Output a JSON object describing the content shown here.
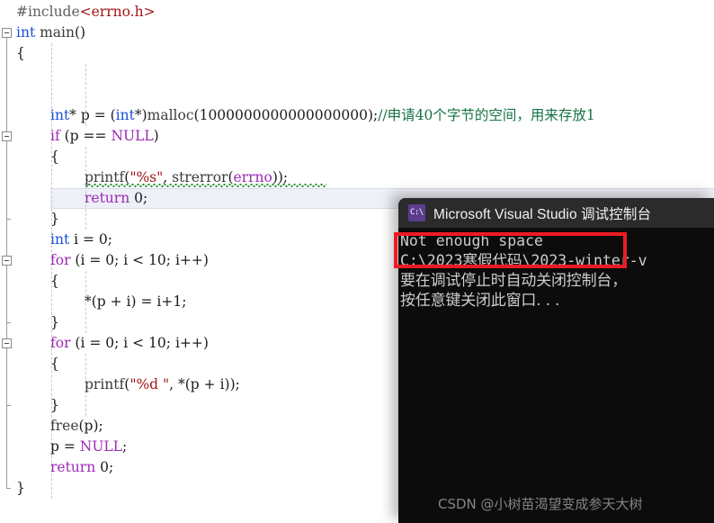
{
  "editor": {
    "name": "visual-studio-code-editor",
    "background": "#ffffff",
    "lines": [
      {
        "indent": 0,
        "tokens": [
          {
            "t": "#include",
            "c": "macro"
          },
          {
            "t": "<errno.h>",
            "c": "hdr"
          }
        ]
      },
      {
        "indent": 0,
        "tokens": [
          {
            "t": "int",
            "c": "kw"
          },
          {
            "t": " ",
            "c": "punc"
          },
          {
            "t": "main",
            "c": "fn"
          },
          {
            "t": "()",
            "c": "punc"
          }
        ]
      },
      {
        "indent": 0,
        "tokens": [
          {
            "t": "{",
            "c": "punc"
          }
        ]
      },
      {
        "indent": 0,
        "tokens": []
      },
      {
        "indent": 0,
        "tokens": []
      },
      {
        "indent": 1,
        "tokens": [
          {
            "t": "int",
            "c": "kw"
          },
          {
            "t": "* p = (",
            "c": "punc"
          },
          {
            "t": "int",
            "c": "kw"
          },
          {
            "t": "*)",
            "c": "punc"
          },
          {
            "t": "malloc",
            "c": "fn"
          },
          {
            "t": "(1000000000000000000);",
            "c": "punc"
          },
          {
            "t": "//申请40个字节的空间，用来存放1",
            "c": "cmt"
          }
        ]
      },
      {
        "indent": 1,
        "tokens": [
          {
            "t": "if",
            "c": "kw2"
          },
          {
            "t": " (p == ",
            "c": "punc"
          },
          {
            "t": "NULL",
            "c": "macroid"
          },
          {
            "t": ")",
            "c": "punc"
          }
        ]
      },
      {
        "indent": 1,
        "tokens": [
          {
            "t": "{",
            "c": "punc"
          }
        ]
      },
      {
        "indent": 2,
        "tokens": [
          {
            "t": "printf",
            "c": "fn"
          },
          {
            "t": "(",
            "c": "punc"
          },
          {
            "t": "\"%s\"",
            "c": "str"
          },
          {
            "t": ", ",
            "c": "punc"
          },
          {
            "t": "strerror",
            "c": "fn"
          },
          {
            "t": "(",
            "c": "punc"
          },
          {
            "t": "errno",
            "c": "macroid"
          },
          {
            "t": "));",
            "c": "punc"
          }
        ]
      },
      {
        "indent": 2,
        "tokens": [
          {
            "t": "return",
            "c": "kw2"
          },
          {
            "t": " 0;",
            "c": "punc"
          }
        ]
      },
      {
        "indent": 1,
        "tokens": [
          {
            "t": "}",
            "c": "punc"
          }
        ]
      },
      {
        "indent": 1,
        "tokens": [
          {
            "t": "int",
            "c": "kw"
          },
          {
            "t": " i = 0;",
            "c": "punc"
          }
        ]
      },
      {
        "indent": 1,
        "tokens": [
          {
            "t": "for",
            "c": "kw2"
          },
          {
            "t": " (i = 0; i < 10; i++)",
            "c": "punc"
          }
        ]
      },
      {
        "indent": 1,
        "tokens": [
          {
            "t": "{",
            "c": "punc"
          }
        ]
      },
      {
        "indent": 2,
        "tokens": [
          {
            "t": "*(p + i) = i+1;",
            "c": "punc"
          }
        ]
      },
      {
        "indent": 1,
        "tokens": [
          {
            "t": "}",
            "c": "punc"
          }
        ]
      },
      {
        "indent": 1,
        "tokens": [
          {
            "t": "for",
            "c": "kw2"
          },
          {
            "t": " (i = 0; i < 10; i++)",
            "c": "punc"
          }
        ]
      },
      {
        "indent": 1,
        "tokens": [
          {
            "t": "{",
            "c": "punc"
          }
        ]
      },
      {
        "indent": 2,
        "tokens": [
          {
            "t": "printf",
            "c": "fn"
          },
          {
            "t": "(",
            "c": "punc"
          },
          {
            "t": "\"%d \"",
            "c": "str"
          },
          {
            "t": ", *(p + i));",
            "c": "punc"
          }
        ]
      },
      {
        "indent": 1,
        "tokens": [
          {
            "t": "}",
            "c": "punc"
          }
        ]
      },
      {
        "indent": 1,
        "tokens": [
          {
            "t": "free",
            "c": "fn"
          },
          {
            "t": "(p);",
            "c": "punc"
          }
        ]
      },
      {
        "indent": 1,
        "tokens": [
          {
            "t": "p = ",
            "c": "punc"
          },
          {
            "t": "NULL",
            "c": "macroid"
          },
          {
            "t": ";",
            "c": "punc"
          }
        ]
      },
      {
        "indent": 1,
        "tokens": [
          {
            "t": "return",
            "c": "kw2"
          },
          {
            "t": " 0;",
            "c": "punc"
          }
        ]
      },
      {
        "indent": 0,
        "tokens": [
          {
            "t": "}",
            "c": "punc"
          }
        ]
      }
    ],
    "current_line_index": 9,
    "squiggle_line_index": 8,
    "fold_boxes": [
      1,
      6,
      12,
      16
    ],
    "comment_text": "//申请40个字节的空间，用来存放1"
  },
  "console": {
    "name": "visual-studio-debug-console",
    "icon": "cmd-icon",
    "icon_glyph": "C:\\",
    "title": "Microsoft Visual Studio 调试控制台",
    "background": "#0c0c0c",
    "titlebar_background": "#2b2b2b",
    "lines": [
      "Not enough space",
      "C:\\2023寒假代码\\2023-winter-v",
      "要在调试停止时自动关闭控制台，",
      "按任意键关闭此窗口. . ."
    ]
  },
  "annotation": {
    "name": "error-highlight-box",
    "color": "#ee1b24",
    "target_text": "Not enough space"
  },
  "watermark": {
    "text": "CSDN @小树苗渴望变成参天大树",
    "color": "#9a9a9a"
  }
}
